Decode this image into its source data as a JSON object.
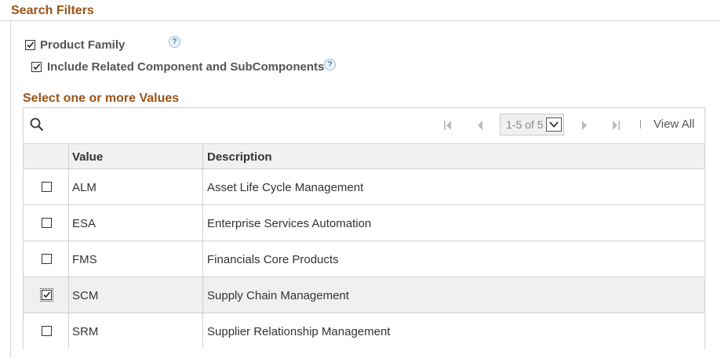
{
  "section": {
    "title": "Search Filters"
  },
  "options": [
    {
      "label": "Product Family",
      "checked": true,
      "help": "?"
    },
    {
      "label": "Include Related Component and SubComponents",
      "checked": true,
      "help": "?"
    }
  ],
  "grid": {
    "title": "Select one or more Values",
    "pager": {
      "text": "1-5 of 5",
      "view_all": "View All"
    },
    "columns": {
      "select": "",
      "value": "Value",
      "description": "Description"
    },
    "rows": [
      {
        "value": "ALM",
        "description": "Asset Life Cycle Management",
        "checked": false
      },
      {
        "value": "ESA",
        "description": "Enterprise Services Automation",
        "checked": false
      },
      {
        "value": "FMS",
        "description": "Financials Core Products",
        "checked": false
      },
      {
        "value": "SCM",
        "description": "Supply Chain Management",
        "checked": true
      },
      {
        "value": "SRM",
        "description": "Supplier Relationship Management",
        "checked": false
      }
    ]
  },
  "colors": {
    "section_title": "#9b5316",
    "selected_row": "#f0f0f0",
    "border": "#d0d0d0"
  },
  "icons": [
    "search-icon",
    "first-page-icon",
    "previous-page-icon",
    "next-page-icon",
    "last-page-icon",
    "help-icon",
    "chevron-down-icon"
  ]
}
